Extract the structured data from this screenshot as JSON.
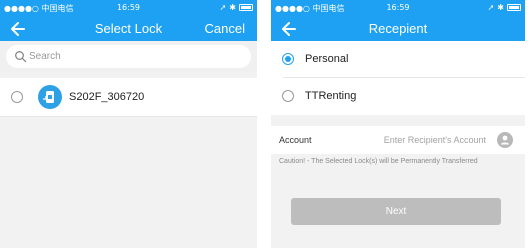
{
  "left_screen": {
    "status_bar": {
      "carrier": "●●●●○ 中国电信 ",
      "time": "16:59"
    },
    "nav": {
      "title": "Select Lock",
      "cancel_label": "Cancel"
    },
    "search": {
      "placeholder": "Search"
    },
    "locks": [
      {
        "name": "S202F_306720",
        "selected": false
      }
    ]
  },
  "right_screen": {
    "status_bar": {
      "carrier": "●●●●○ 中国电信 ",
      "time": "16:59"
    },
    "nav": {
      "title": "Recepient"
    },
    "recipient_types": [
      {
        "label": "Personal",
        "selected": true
      },
      {
        "label": "TTRenting",
        "selected": false
      }
    ],
    "account": {
      "label": "Account",
      "placeholder": "Enter Recipient's Account"
    },
    "caution": "Caution! - The Selected Lock(s) will be Permanently Transferred",
    "next_label": "Next"
  },
  "colors": {
    "brand_blue": "#1ea1f2",
    "disabled_button": "#bdbdbd"
  }
}
